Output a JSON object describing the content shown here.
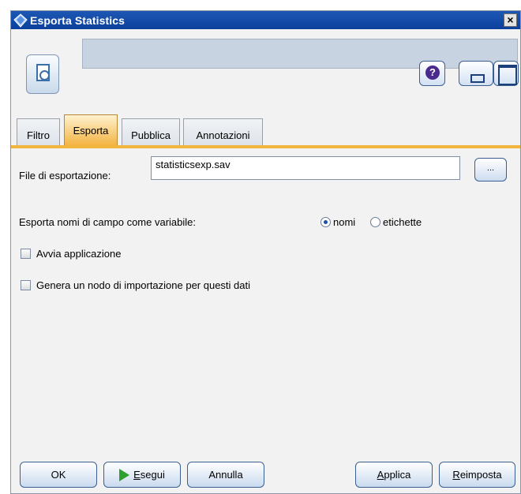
{
  "window": {
    "title": "Esporta Statistics",
    "close_glyph": "×"
  },
  "header": {
    "help_glyph": "?",
    "node_icon": "statistics-export-icon"
  },
  "tabs": [
    {
      "label": "Filtro",
      "active": false
    },
    {
      "label": "Esporta",
      "active": true
    },
    {
      "label": "Pubblica",
      "active": false
    },
    {
      "label": "Annotazioni",
      "active": false
    }
  ],
  "export": {
    "file_label": "File di esportazione:",
    "file_value": "statisticsexp.sav",
    "browse_label": "...",
    "fieldnames_label": "Esporta nomi di campo come variabile:",
    "radio_names": "nomi",
    "radio_labels": "etichette",
    "selected_radio": "nomi",
    "launch_label": "Avvia applicazione",
    "launch_checked": false,
    "generate_label": "Genera un nodo di importazione per questi dati",
    "generate_checked": false
  },
  "buttons": {
    "ok": "OK",
    "run_ul": "E",
    "run_rest": "segui",
    "cancel": "Annulla",
    "apply_ul": "A",
    "apply_rest": "pplica",
    "reset_ul": "R",
    "reset_rest": "eimposta"
  },
  "colors": {
    "titlebar": "#0b3f9c",
    "tab_active": "#f3b443",
    "tab_strip": "#f2b53f"
  }
}
